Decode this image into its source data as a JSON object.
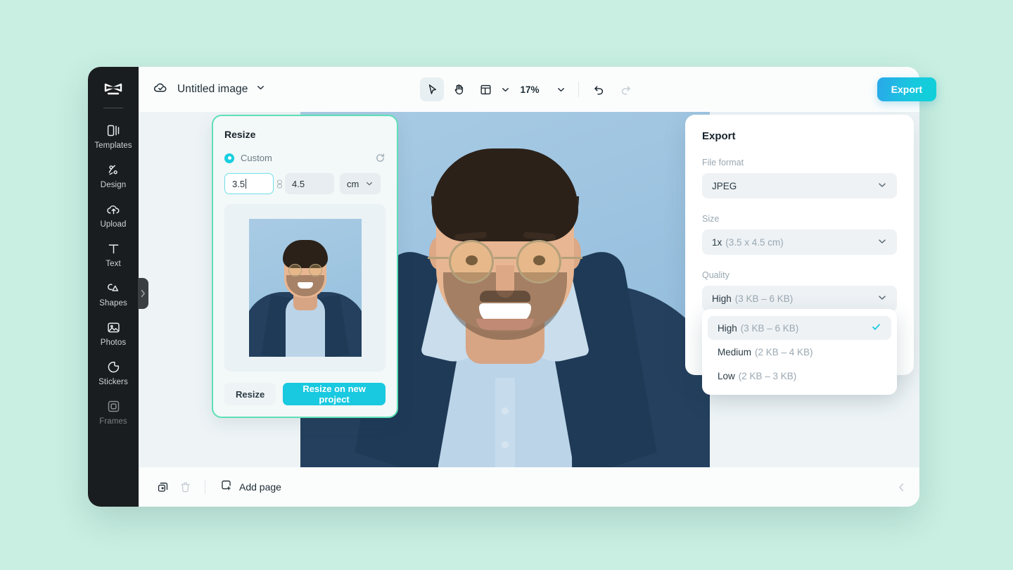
{
  "theme": {
    "page_background": "#c8efe1",
    "accent_cyan": "#18c9e0",
    "accent_mint_border": "#5fe0b6",
    "rail_background": "#1a1d1f",
    "canvas_background": "#eef4f6",
    "photo_backdrop": "#9cc3e0",
    "suit_navy": "#24405e"
  },
  "sidebar": {
    "logo_name": "capcut-logo",
    "items": [
      {
        "label": "Templates",
        "icon": "templates-icon"
      },
      {
        "label": "Design",
        "icon": "design-icon"
      },
      {
        "label": "Upload",
        "icon": "upload-icon"
      },
      {
        "label": "Text",
        "icon": "text-icon"
      },
      {
        "label": "Shapes",
        "icon": "shapes-icon"
      },
      {
        "label": "Photos",
        "icon": "photos-icon"
      },
      {
        "label": "Stickers",
        "icon": "stickers-icon"
      },
      {
        "label": "Frames",
        "icon": "frames-icon"
      }
    ],
    "collapse_icon": "chevron-right-icon"
  },
  "topbar": {
    "cloud_icon": "cloud-saved-icon",
    "document_title": "Untitled image",
    "title_dropdown_icon": "chevron-down-icon",
    "tools": [
      {
        "name": "select-tool",
        "icon": "cursor-arrow-icon",
        "active": true
      },
      {
        "name": "hand-tool",
        "icon": "hand-icon",
        "active": false
      },
      {
        "name": "layout-tool",
        "icon": "layout-icon",
        "active": false
      }
    ],
    "layout_dropdown_icon": "chevron-down-icon",
    "zoom_level": "17%",
    "zoom_dropdown_icon": "chevron-down-icon",
    "undo_icon": "undo-icon",
    "redo_icon": "redo-icon",
    "export_label": "Export"
  },
  "resize_panel": {
    "title": "Resize",
    "preset_option": "Custom",
    "reset_icon": "reset-icon",
    "width_value": "3.5",
    "height_value": "4.5",
    "link_icon": "link-dimensions-icon",
    "unit_value": "cm",
    "unit_dropdown_icon": "chevron-down-icon",
    "preview_alt": "portrait-preview",
    "resize_label": "Resize",
    "resize_new_project_label": "Resize on new project"
  },
  "export_panel": {
    "title": "Export",
    "file_format_label": "File format",
    "file_format_value": "JPEG",
    "size_label": "Size",
    "size_value_strong": "1x",
    "size_value_muted": "(3.5 x 4.5 cm)",
    "quality_label": "Quality",
    "quality_value_strong": "High",
    "quality_value_muted": "(3 KB – 6 KB)",
    "dropdown_icon": "chevron-down-icon",
    "quality_options": [
      {
        "name": "High",
        "range": "(3 KB – 6 KB)",
        "selected": true
      },
      {
        "name": "Medium",
        "range": "(2 KB – 4 KB)",
        "selected": false
      },
      {
        "name": "Low",
        "range": "(2 KB – 3 KB)",
        "selected": false
      }
    ],
    "check_icon": "check-icon"
  },
  "bottombar": {
    "duplicate_icon": "duplicate-page-icon",
    "delete_icon": "trash-icon",
    "add_page_icon": "add-page-icon",
    "add_page_label": "Add page",
    "collapse_icon": "chevron-left-icon"
  }
}
